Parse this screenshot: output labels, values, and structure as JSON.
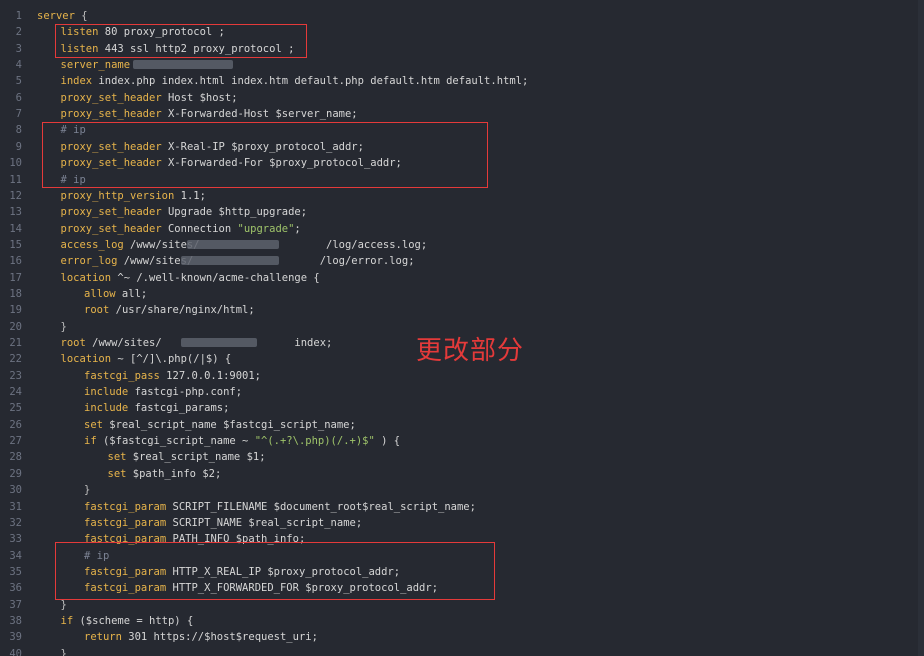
{
  "editor": {
    "annotation": "更改部分",
    "colors": {
      "background": "#262931",
      "keyword": "#e7b44b",
      "string": "#9fc46a",
      "comment": "#7c8394",
      "highlight_box": "#e43a3a"
    },
    "lines": [
      {
        "n": "1",
        "indent": 0,
        "tokens": [
          [
            "k",
            "server"
          ],
          [
            "p",
            " {"
          ]
        ]
      },
      {
        "n": "2",
        "indent": 1,
        "tokens": [
          [
            "k",
            "listen"
          ],
          [
            "v",
            " 80 proxy_protocol ;"
          ]
        ]
      },
      {
        "n": "3",
        "indent": 1,
        "tokens": [
          [
            "k",
            "listen"
          ],
          [
            "v",
            " 443 ssl http2 proxy_protocol ;"
          ]
        ]
      },
      {
        "n": "4",
        "indent": 1,
        "tokens": [
          [
            "k",
            "server_name"
          ],
          [
            "v",
            " "
          ]
        ]
      },
      {
        "n": "5",
        "indent": 1,
        "tokens": [
          [
            "k",
            "index"
          ],
          [
            "v",
            " index.php index.html index.htm default.php default.htm default.html;"
          ]
        ]
      },
      {
        "n": "6",
        "indent": 1,
        "tokens": [
          [
            "k",
            "proxy_set_header"
          ],
          [
            "v",
            " Host $host;"
          ]
        ]
      },
      {
        "n": "7",
        "indent": 1,
        "tokens": [
          [
            "k",
            "proxy_set_header"
          ],
          [
            "v",
            " X-Forwarded-Host $server_name;"
          ]
        ]
      },
      {
        "n": "8",
        "indent": 1,
        "tokens": [
          [
            "c",
            "# ip"
          ]
        ]
      },
      {
        "n": "9",
        "indent": 1,
        "tokens": [
          [
            "k",
            "proxy_set_header"
          ],
          [
            "v",
            " X-Real-IP $proxy_protocol_addr;"
          ]
        ]
      },
      {
        "n": "10",
        "indent": 1,
        "tokens": [
          [
            "k",
            "proxy_set_header"
          ],
          [
            "v",
            " X-Forwarded-For $proxy_protocol_addr;"
          ]
        ]
      },
      {
        "n": "11",
        "indent": 1,
        "tokens": [
          [
            "c",
            "# ip"
          ]
        ]
      },
      {
        "n": "12",
        "indent": 1,
        "tokens": [
          [
            "k",
            "proxy_http_version"
          ],
          [
            "v",
            " 1.1;"
          ]
        ]
      },
      {
        "n": "13",
        "indent": 1,
        "tokens": [
          [
            "k",
            "proxy_set_header"
          ],
          [
            "v",
            " Upgrade $http_upgrade;"
          ]
        ]
      },
      {
        "n": "14",
        "indent": 1,
        "tokens": [
          [
            "k",
            "proxy_set_header"
          ],
          [
            "v",
            " Connection "
          ],
          [
            "s",
            "\"upgrade\""
          ],
          [
            "v",
            ";"
          ]
        ]
      },
      {
        "n": "15",
        "indent": 1,
        "tokens": [
          [
            "k",
            "access_log"
          ],
          [
            "v",
            " /www/sites/                    /log/access.log;"
          ]
        ]
      },
      {
        "n": "16",
        "indent": 1,
        "tokens": [
          [
            "k",
            "error_log"
          ],
          [
            "v",
            " /www/sites/                    /log/error.log;"
          ]
        ]
      },
      {
        "n": "17",
        "indent": 1,
        "tokens": [
          [
            "k",
            "location"
          ],
          [
            "v",
            " ^~ /.well-known/acme-challenge {"
          ]
        ]
      },
      {
        "n": "18",
        "indent": 2,
        "tokens": [
          [
            "k",
            "allow"
          ],
          [
            "v",
            " all;"
          ]
        ]
      },
      {
        "n": "19",
        "indent": 2,
        "tokens": [
          [
            "k",
            "root"
          ],
          [
            "v",
            " /usr/share/nginx/html;"
          ]
        ]
      },
      {
        "n": "20",
        "indent": 1,
        "tokens": [
          [
            "p",
            "}"
          ]
        ]
      },
      {
        "n": "21",
        "indent": 1,
        "tokens": [
          [
            "k",
            "root"
          ],
          [
            "v",
            " /www/sites/                     index;"
          ]
        ]
      },
      {
        "n": "22",
        "indent": 1,
        "tokens": [
          [
            "k",
            "location"
          ],
          [
            "v",
            " ~ [^/]\\.php(/|$) {"
          ]
        ]
      },
      {
        "n": "23",
        "indent": 2,
        "tokens": [
          [
            "k",
            "fastcgi_pass"
          ],
          [
            "v",
            " 127.0.0.1:9001;"
          ]
        ]
      },
      {
        "n": "24",
        "indent": 2,
        "tokens": [
          [
            "k",
            "include"
          ],
          [
            "v",
            " fastcgi-php.conf;"
          ]
        ]
      },
      {
        "n": "25",
        "indent": 2,
        "tokens": [
          [
            "k",
            "include"
          ],
          [
            "v",
            " fastcgi_params;"
          ]
        ]
      },
      {
        "n": "26",
        "indent": 2,
        "tokens": [
          [
            "k",
            "set"
          ],
          [
            "v",
            " $real_script_name $fastcgi_script_name;"
          ]
        ]
      },
      {
        "n": "27",
        "indent": 2,
        "tokens": [
          [
            "k",
            "if"
          ],
          [
            "v",
            " ($fastcgi_script_name ~ "
          ],
          [
            "s",
            "\"^(.+?\\.php)(/.+)$\""
          ],
          [
            "v",
            " ) {"
          ]
        ]
      },
      {
        "n": "28",
        "indent": 3,
        "tokens": [
          [
            "k",
            "set"
          ],
          [
            "v",
            " $real_script_name $1;"
          ]
        ]
      },
      {
        "n": "29",
        "indent": 3,
        "tokens": [
          [
            "k",
            "set"
          ],
          [
            "v",
            " $path_info $2;"
          ]
        ]
      },
      {
        "n": "30",
        "indent": 2,
        "tokens": [
          [
            "p",
            "}"
          ]
        ]
      },
      {
        "n": "31",
        "indent": 2,
        "tokens": [
          [
            "k",
            "fastcgi_param"
          ],
          [
            "v",
            " SCRIPT_FILENAME $document_root$real_script_name;"
          ]
        ]
      },
      {
        "n": "32",
        "indent": 2,
        "tokens": [
          [
            "k",
            "fastcgi_param"
          ],
          [
            "v",
            " SCRIPT_NAME $real_script_name;"
          ]
        ]
      },
      {
        "n": "33",
        "indent": 2,
        "tokens": [
          [
            "k",
            "fastcgi_param"
          ],
          [
            "v",
            " PATH_INFO $path_info;"
          ]
        ]
      },
      {
        "n": "34",
        "indent": 2,
        "tokens": [
          [
            "c",
            "# ip"
          ]
        ]
      },
      {
        "n": "35",
        "indent": 2,
        "tokens": [
          [
            "k",
            "fastcgi_param"
          ],
          [
            "v",
            " HTTP_X_REAL_IP $proxy_protocol_addr;"
          ]
        ]
      },
      {
        "n": "36",
        "indent": 2,
        "tokens": [
          [
            "k",
            "fastcgi_param"
          ],
          [
            "v",
            " HTTP_X_FORWARDED_FOR $proxy_protocol_addr;"
          ]
        ]
      },
      {
        "n": "37",
        "indent": 1,
        "tokens": [
          [
            "p",
            "}"
          ]
        ]
      },
      {
        "n": "38",
        "indent": 1,
        "tokens": [
          [
            "k",
            "if"
          ],
          [
            "v",
            " ($scheme = http) {"
          ]
        ]
      },
      {
        "n": "39",
        "indent": 2,
        "tokens": [
          [
            "k",
            "return"
          ],
          [
            "v",
            " 301 https://$host$request_uri;"
          ]
        ]
      },
      {
        "n": "40",
        "indent": 1,
        "tokens": [
          [
            "p",
            "}"
          ]
        ]
      }
    ]
  }
}
